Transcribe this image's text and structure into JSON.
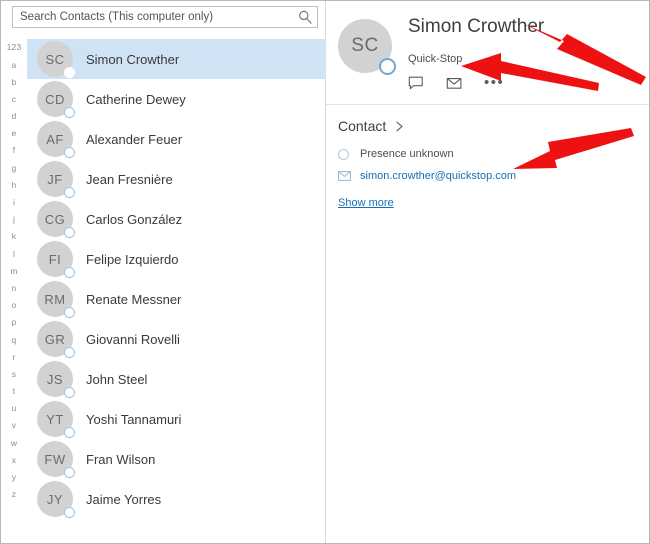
{
  "search": {
    "placeholder": "Search Contacts (This computer only)",
    "value": "",
    "icon": "search-icon"
  },
  "alpha_index": [
    "123",
    "a",
    "b",
    "c",
    "d",
    "e",
    "f",
    "g",
    "h",
    "i",
    "j",
    "k",
    "l",
    "m",
    "n",
    "o",
    "p",
    "q",
    "r",
    "s",
    "t",
    "u",
    "v",
    "w",
    "x",
    "y",
    "z"
  ],
  "contacts": [
    {
      "initials": "SC",
      "name": "Simon Crowther",
      "selected": true
    },
    {
      "initials": "CD",
      "name": "Catherine Dewey",
      "selected": false
    },
    {
      "initials": "AF",
      "name": "Alexander Feuer",
      "selected": false
    },
    {
      "initials": "JF",
      "name": "Jean Fresnière",
      "selected": false
    },
    {
      "initials": "CG",
      "name": "Carlos González",
      "selected": false
    },
    {
      "initials": "FI",
      "name": "Felipe Izquierdo",
      "selected": false
    },
    {
      "initials": "RM",
      "name": "Renate Messner",
      "selected": false
    },
    {
      "initials": "GR",
      "name": "Giovanni Rovelli",
      "selected": false
    },
    {
      "initials": "JS",
      "name": "John Steel",
      "selected": false
    },
    {
      "initials": "YT",
      "name": "Yoshi Tannamuri",
      "selected": false
    },
    {
      "initials": "FW",
      "name": "Fran Wilson",
      "selected": false
    },
    {
      "initials": "JY",
      "name": "Jaime Yorres",
      "selected": false
    }
  ],
  "detail": {
    "initials": "SC",
    "name": "Simon Crowther",
    "company": "Quick-Stop",
    "actions": [
      {
        "icon": "chat-bubble-icon",
        "label": "Send instant message"
      },
      {
        "icon": "envelope-icon",
        "label": "Send email"
      },
      {
        "icon": "ellipsis-icon",
        "label": "More options"
      }
    ],
    "section_label": "Contact",
    "presence_status": "Presence unknown",
    "email": "simon.crowther@quickstop.com",
    "show_more_label": "Show more"
  },
  "colors": {
    "selection": "#cfe3f5",
    "link": "#1670b8",
    "avatar_bg": "#d2d2d2",
    "annotation_arrow": "#ee1111"
  }
}
